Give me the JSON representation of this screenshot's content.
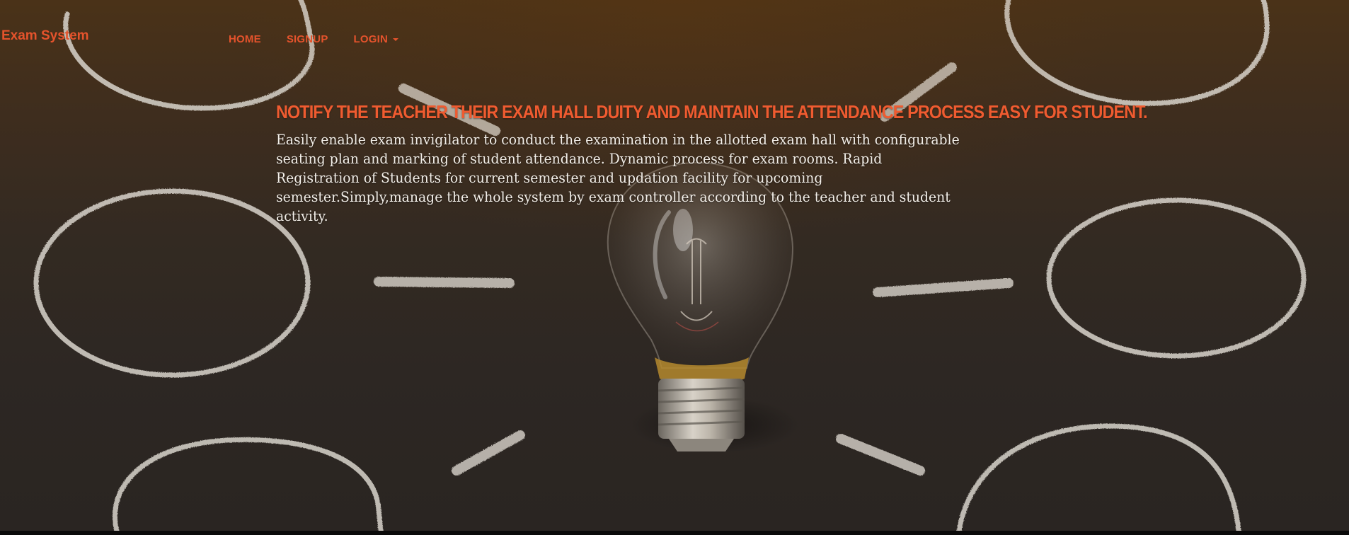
{
  "brand": {
    "name": "Exam System"
  },
  "nav": {
    "items": [
      {
        "label": "HOME"
      },
      {
        "label": "SIGNUP"
      },
      {
        "label": "LOGIN"
      }
    ]
  },
  "hero": {
    "headline": "NOTIFY THE TEACHER THEIR EXAM HALL DUITY AND MAINTAIN THE ATTENDANCE PROCESS EASY FOR STUDENT.",
    "description": "Easily enable exam invigilator to conduct the examination in the allotted exam hall with configurable seating plan and marking of student attendance. Dynamic process for exam rooms. Rapid Registration of Students for current semester and updation facility for upcoming semester.Simply,manage the whole system by exam controller according to the teacher and student activity.",
    "background_image": "chalkboard-lightbulb"
  },
  "colors": {
    "accent": "#e5532c",
    "text_light": "#f3efe9"
  }
}
